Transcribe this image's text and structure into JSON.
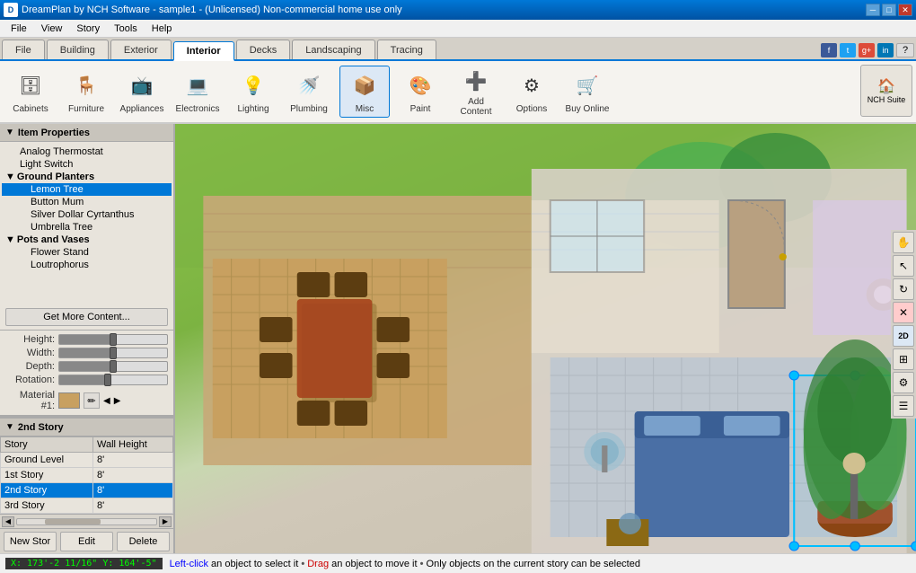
{
  "titlebar": {
    "title": "DreamPlan by NCH Software - sample1 - (Unlicensed) Non-commercial home use only",
    "app_icon": "D",
    "controls": [
      "minimize",
      "maximize",
      "close"
    ]
  },
  "menubar": {
    "items": [
      "File",
      "View",
      "Story",
      "Tools",
      "Help"
    ]
  },
  "tabs": {
    "items": [
      "File",
      "Building",
      "Exterior",
      "Interior",
      "Decks",
      "Landscaping",
      "Tracing"
    ],
    "active": "Interior"
  },
  "toolbar": {
    "groups": [
      {
        "id": "cabinets",
        "label": "Cabinets",
        "icon": "🗄"
      },
      {
        "id": "furniture",
        "label": "Furniture",
        "icon": "🪑"
      },
      {
        "id": "appliances",
        "label": "Appliances",
        "icon": "📺"
      },
      {
        "id": "electronics",
        "label": "Electronics",
        "icon": "💻"
      },
      {
        "id": "lighting",
        "label": "Lighting",
        "icon": "💡"
      },
      {
        "id": "plumbing",
        "label": "Plumbing",
        "icon": "🚿"
      },
      {
        "id": "misc",
        "label": "Misc",
        "icon": "📦"
      },
      {
        "id": "paint",
        "label": "Paint",
        "icon": "🎨"
      },
      {
        "id": "add_content",
        "label": "Add Content",
        "icon": "➕"
      },
      {
        "id": "options",
        "label": "Options",
        "icon": "⚙"
      },
      {
        "id": "buy_online",
        "label": "Buy Online",
        "icon": "🛒"
      }
    ],
    "active": "misc",
    "nch_suite_label": "NCH Suite"
  },
  "right_toolbar": {
    "buttons": [
      {
        "id": "hand",
        "icon": "✋",
        "type": "normal"
      },
      {
        "id": "cursor",
        "icon": "↖",
        "type": "normal"
      },
      {
        "id": "orbit",
        "icon": "🔄",
        "type": "normal"
      },
      {
        "id": "delete",
        "icon": "✕",
        "type": "red"
      },
      {
        "id": "2d",
        "label": "2D",
        "type": "twod"
      },
      {
        "id": "layers",
        "icon": "⊞",
        "type": "normal"
      },
      {
        "id": "settings",
        "icon": "⚙",
        "type": "normal"
      },
      {
        "id": "menu2",
        "icon": "☰",
        "type": "normal"
      }
    ]
  },
  "item_properties": {
    "title": "Item Properties",
    "tree": [
      {
        "id": "analog_thermostat",
        "label": "Analog Thermostat",
        "level": 2,
        "type": "leaf"
      },
      {
        "id": "light_switch",
        "label": "Light Switch",
        "level": 2,
        "type": "leaf"
      },
      {
        "id": "ground_planters",
        "label": "Ground Planters",
        "level": 1,
        "type": "group",
        "expanded": true
      },
      {
        "id": "lemon_tree",
        "label": "Lemon Tree",
        "level": 2,
        "type": "leaf",
        "selected": true
      },
      {
        "id": "button_mum",
        "label": "Button Mum",
        "level": 2,
        "type": "leaf"
      },
      {
        "id": "silver_dollar",
        "label": "Silver Dollar Cyrtanthus",
        "level": 2,
        "type": "leaf"
      },
      {
        "id": "umbrella_tree",
        "label": "Umbrella Tree",
        "level": 2,
        "type": "leaf"
      },
      {
        "id": "pots_vases",
        "label": "Pots and Vases",
        "level": 1,
        "type": "group",
        "expanded": true
      },
      {
        "id": "flower_stand",
        "label": "Flower Stand",
        "level": 2,
        "type": "leaf"
      },
      {
        "id": "loutrophorus",
        "label": "Loutrophorus",
        "level": 2,
        "type": "leaf"
      }
    ],
    "get_more_label": "Get More Content...",
    "properties": {
      "height_label": "Height:",
      "width_label": "Width:",
      "depth_label": "Depth:",
      "rotation_label": "Rotation:",
      "material_label": "Material #1:"
    }
  },
  "story_section": {
    "title": "2nd Story",
    "columns": [
      "Story",
      "Wall Height"
    ],
    "rows": [
      {
        "story": "Ground Level",
        "wall_height": "8'",
        "active": false
      },
      {
        "story": "1st Story",
        "wall_height": "8'",
        "active": false
      },
      {
        "story": "2nd Story",
        "wall_height": "8'",
        "active": true
      },
      {
        "story": "3rd Story",
        "wall_height": "8'",
        "active": false
      }
    ],
    "buttons": {
      "new_story": "New Stor",
      "edit": "Edit",
      "delete": "Delete"
    }
  },
  "statusbar": {
    "coords": "X: 173'-2 11/16\"  Y: 164'-5\"",
    "message": "Left-click an object to select it",
    "message2": "Drag an object to move it",
    "message3": "Only objects on the current story can be selected",
    "separator": "•"
  },
  "social": {
    "buttons": [
      "f",
      "t",
      "g+",
      "in",
      "?"
    ]
  }
}
